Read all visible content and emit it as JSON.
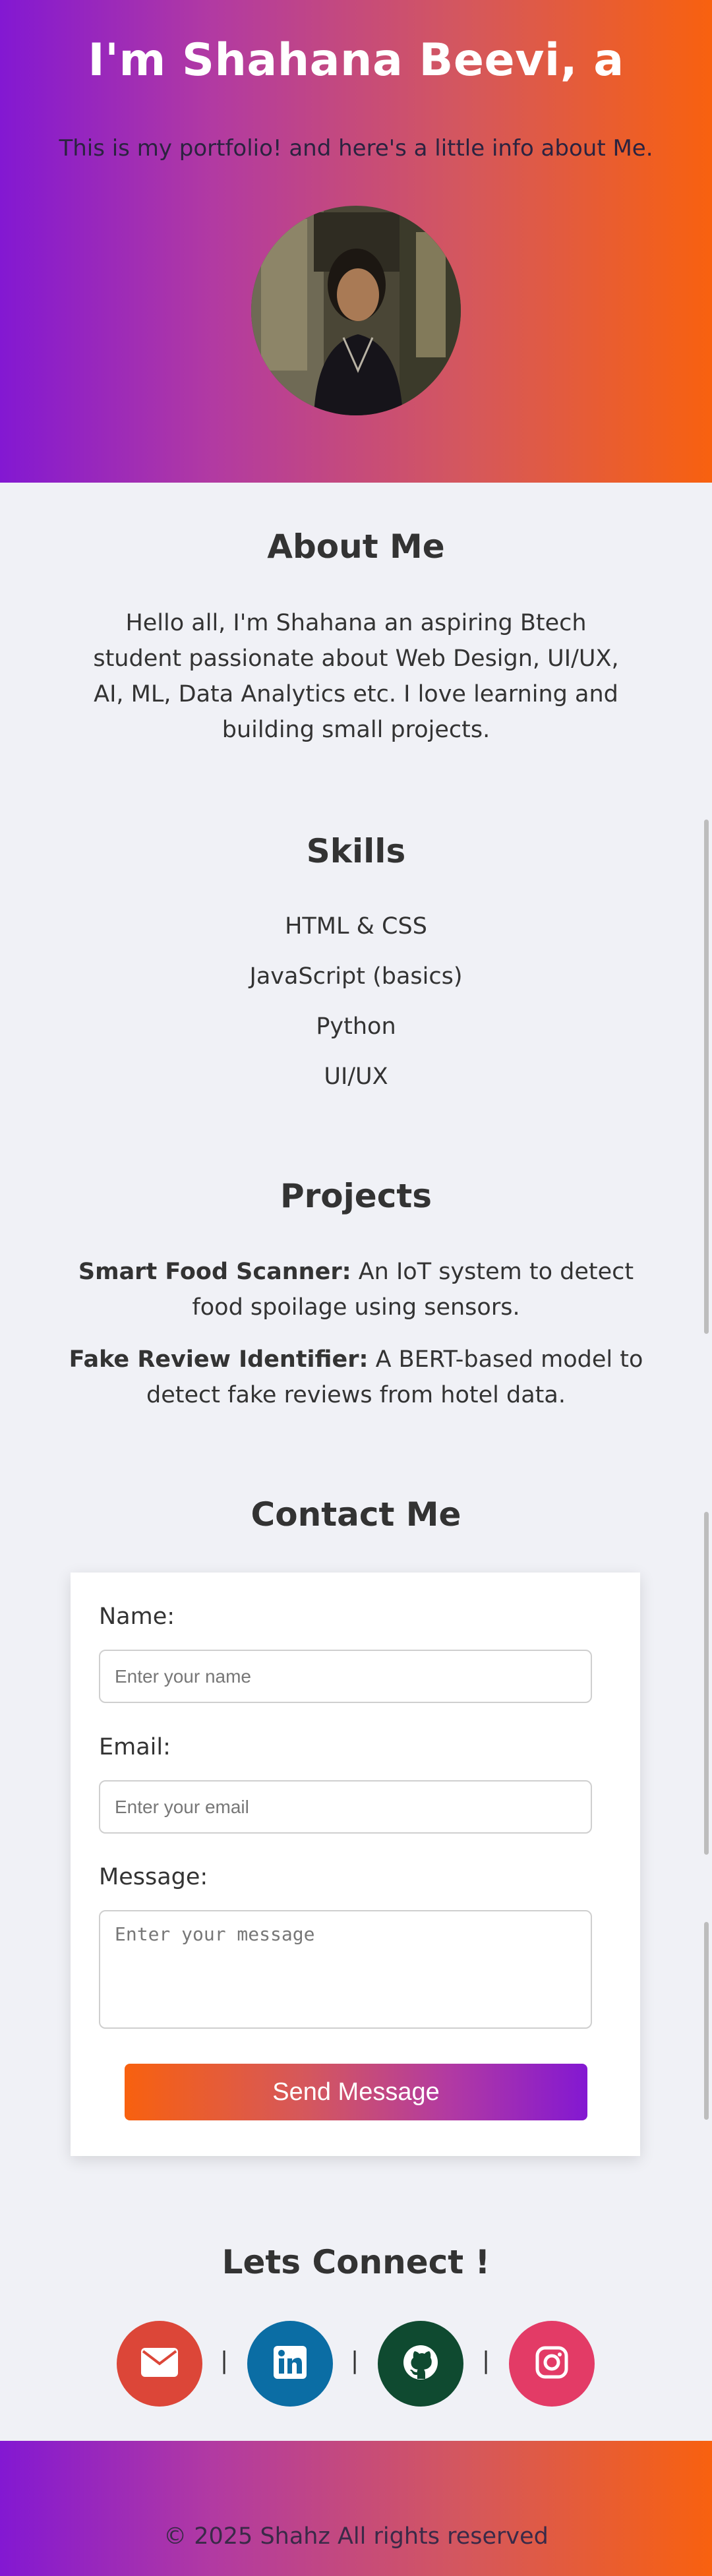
{
  "hero": {
    "title": "I'm Shahana Beevi, a",
    "subtitle": "This is my portfolio! and here's a little info about Me."
  },
  "about": {
    "title": "About Me",
    "text": "Hello all, I'm Shahana an aspiring Btech student passionate about Web Design, UI/UX, AI, ML, Data Analytics etc. I love learning and building small projects."
  },
  "skills": {
    "title": "Skills",
    "items": [
      "HTML & CSS",
      "JavaScript (basics)",
      "Python",
      "UI/UX"
    ]
  },
  "projects": {
    "title": "Projects",
    "items": [
      {
        "name": "Smart Food Scanner:",
        "desc": " An IoT system to detect food spoilage using sensors."
      },
      {
        "name": "Fake Review Identifier:",
        "desc": " A BERT-based model to detect fake reviews from hotel data."
      }
    ]
  },
  "contact": {
    "title": "Contact Me",
    "name_label": "Name:",
    "name_placeholder": "Enter your name",
    "email_label": "Email:",
    "email_placeholder": "Enter your email",
    "message_label": "Message:",
    "message_placeholder": "Enter your message",
    "send_label": "Send Message"
  },
  "connect": {
    "title": "Lets Connect !",
    "separator": "|",
    "links": [
      {
        "icon": "email-icon",
        "color": "#dc4638"
      },
      {
        "icon": "linkedin-icon",
        "color": "#0b6da4"
      },
      {
        "icon": "github-icon",
        "color": "#0f4a30"
      },
      {
        "icon": "instagram-icon",
        "color": "#e33b66"
      }
    ]
  },
  "footer": {
    "copyright": "© 2025 Shahz All rights reserved"
  },
  "colors": {
    "gradient_start": "#8318d2",
    "gradient_end": "#f8610f",
    "page_background": "#f0f1f6"
  }
}
